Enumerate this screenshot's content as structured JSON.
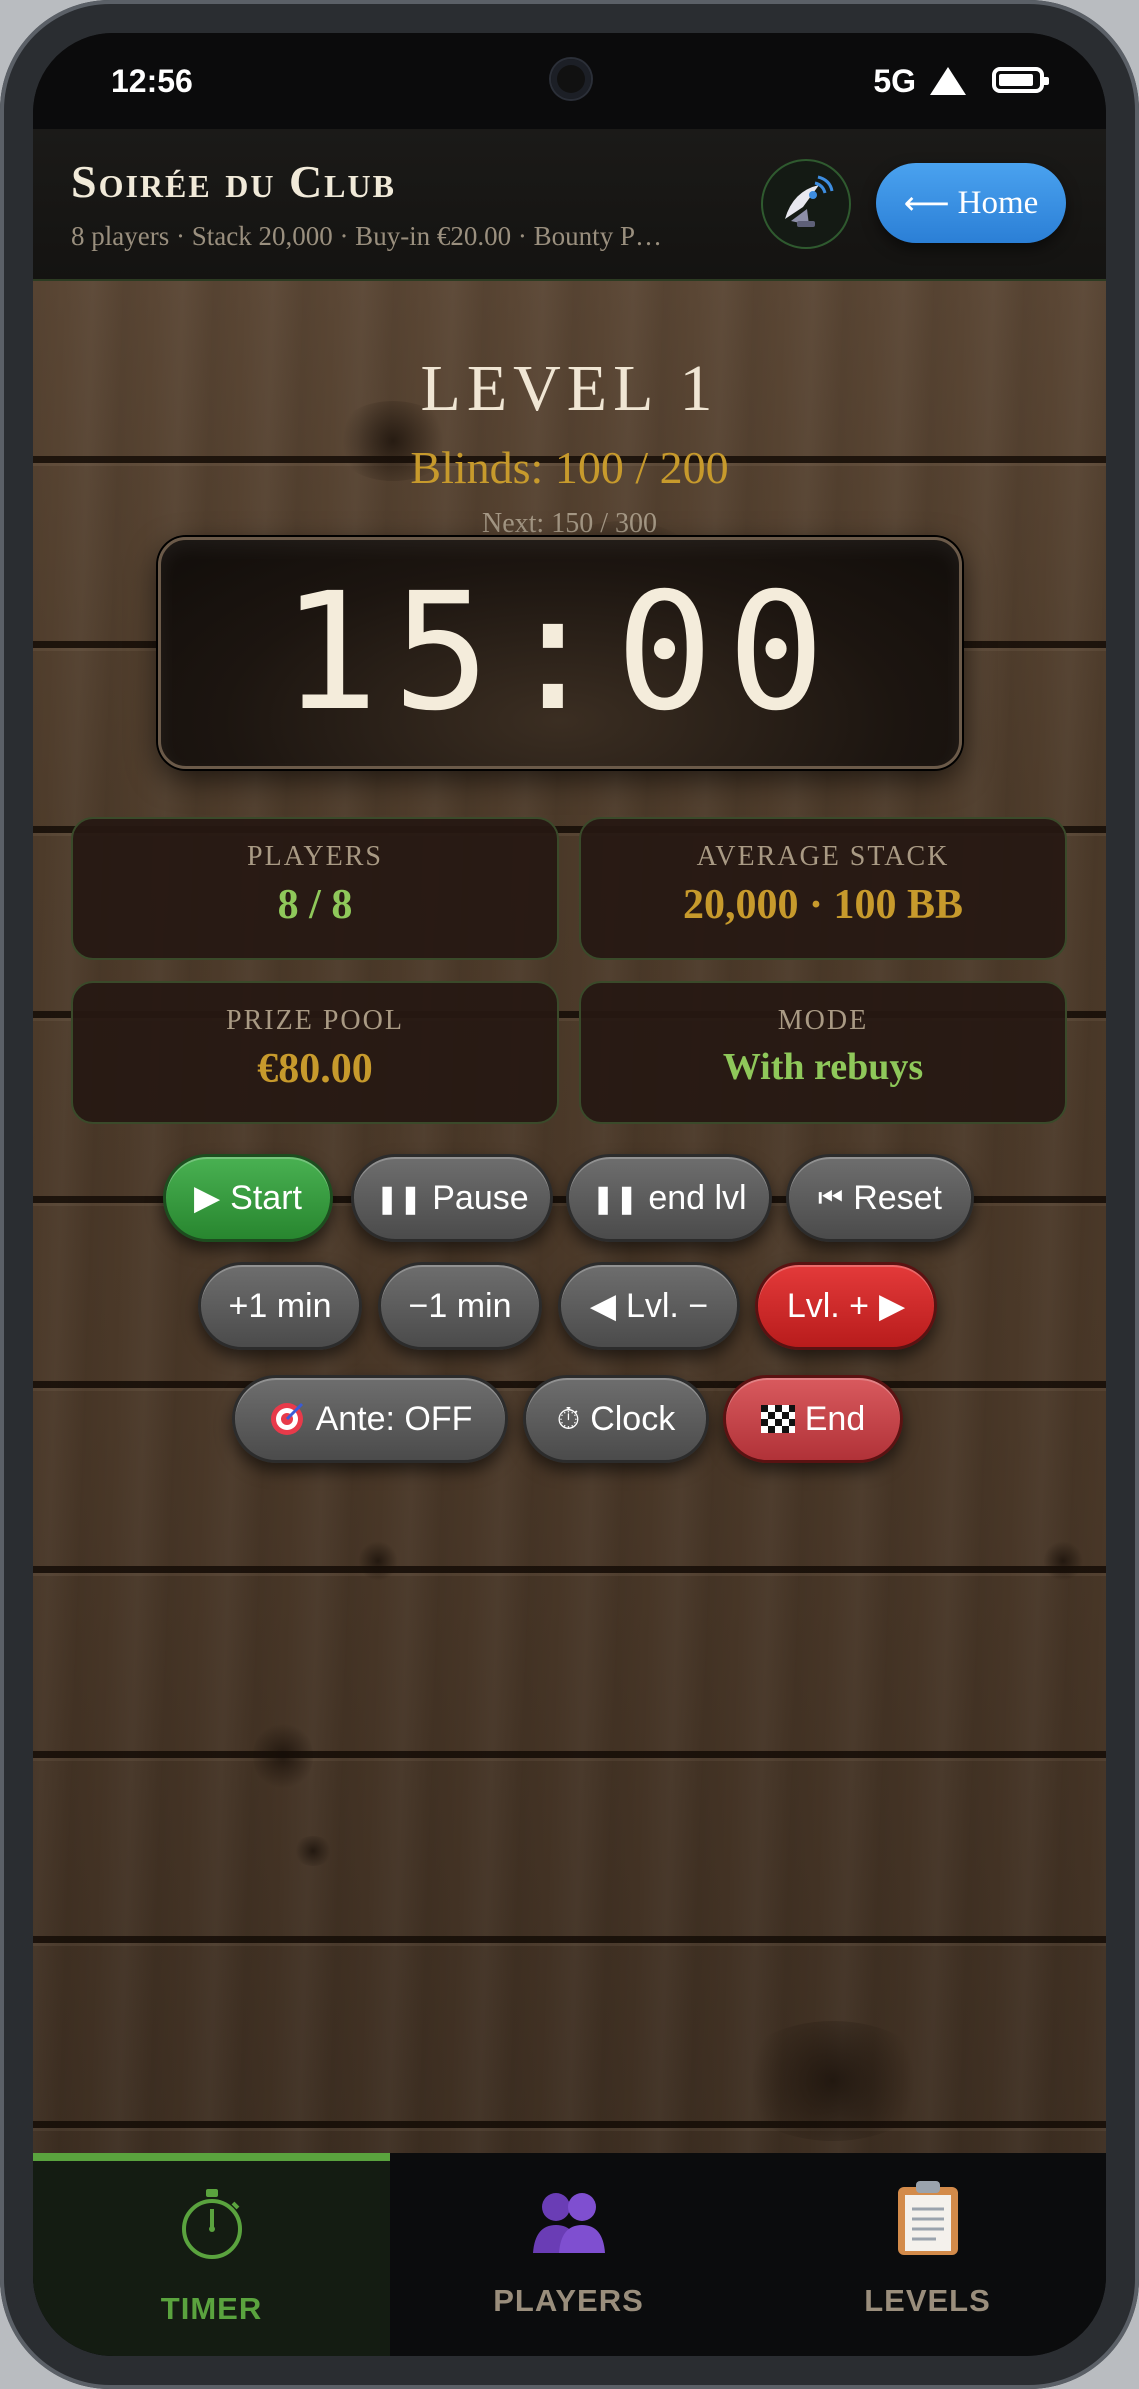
{
  "status": {
    "time": "12:56",
    "network": "5G"
  },
  "header": {
    "title": "Soirée du Club",
    "subtitle": "8 players · Stack 20,000 · Buy-in €20.00 · Bounty P…",
    "home_label": "Home"
  },
  "timer": {
    "level": "LEVEL 1",
    "blinds": "Blinds: 100 / 200",
    "next": "Next: 150 / 300",
    "clock": "15:00"
  },
  "stats": {
    "players": {
      "label": "PLAYERS",
      "value": "8 / 8"
    },
    "average_stack": {
      "label": "AVERAGE STACK",
      "value": "20,000 · 100 BB"
    },
    "prize_pool": {
      "label": "PRIZE POOL",
      "value": "€80.00"
    },
    "mode": {
      "label": "MODE",
      "value": "With rebuys"
    }
  },
  "controls": {
    "start": "Start",
    "pause": "Pause",
    "end_level": "end lvl",
    "reset": "Reset",
    "plus_min": "+1 min",
    "minus_min": "−1 min",
    "level_down": "Lvl. −",
    "level_up": "Lvl. +",
    "ante": "Ante: OFF",
    "clock": "Clock",
    "end": "End"
  },
  "nav": {
    "tabs": [
      {
        "label": "TIMER",
        "active": true
      },
      {
        "label": "PLAYERS",
        "active": false
      },
      {
        "label": "LEVELS",
        "active": false
      }
    ]
  },
  "colors": {
    "accent_green": "#5aa33e",
    "gold": "#c79a2c",
    "value_green": "#8fc85a",
    "home_blue": "#3a8fe6",
    "danger_red": "#d42a2a"
  },
  "icons": {
    "satellite": "satellite-dish-icon",
    "home_arrow": "arrow-left-icon",
    "start": "play-icon",
    "pause": "pause-icon",
    "reset": "skip-back-icon",
    "level_down": "triangle-left-icon",
    "level_up": "triangle-right-icon",
    "ante": "target-icon",
    "clock": "stopwatch-icon",
    "end": "checkered-flag-icon",
    "timer_tab": "stopwatch-icon",
    "players_tab": "people-icon",
    "levels_tab": "clipboard-icon"
  }
}
